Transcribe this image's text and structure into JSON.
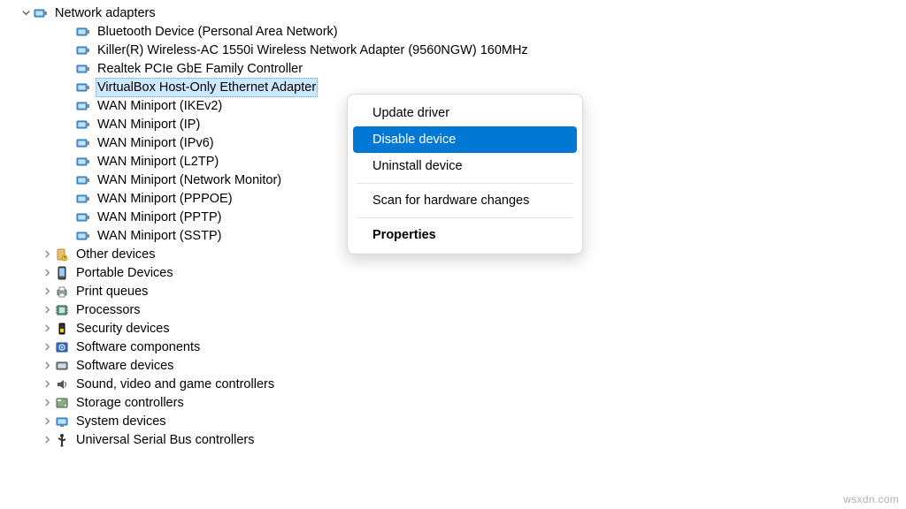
{
  "tree": {
    "root": {
      "label": "Network adapters",
      "icon": "network-adapter-icon",
      "expanded": true
    },
    "devices": [
      {
        "label": "Bluetooth Device (Personal Area Network)",
        "icon": "network-adapter-icon"
      },
      {
        "label": "Killer(R) Wireless-AC 1550i Wireless Network Adapter (9560NGW) 160MHz",
        "icon": "network-adapter-icon"
      },
      {
        "label": "Realtek PCIe GbE Family Controller",
        "icon": "network-adapter-icon"
      },
      {
        "label": "VirtualBox Host-Only Ethernet Adapter",
        "icon": "network-adapter-icon",
        "selected": true
      },
      {
        "label": "WAN Miniport (IKEv2)",
        "icon": "network-adapter-icon"
      },
      {
        "label": "WAN Miniport (IP)",
        "icon": "network-adapter-icon"
      },
      {
        "label": "WAN Miniport (IPv6)",
        "icon": "network-adapter-icon"
      },
      {
        "label": "WAN Miniport (L2TP)",
        "icon": "network-adapter-icon"
      },
      {
        "label": "WAN Miniport (Network Monitor)",
        "icon": "network-adapter-icon"
      },
      {
        "label": "WAN Miniport (PPPOE)",
        "icon": "network-adapter-icon"
      },
      {
        "label": "WAN Miniport (PPTP)",
        "icon": "network-adapter-icon"
      },
      {
        "label": "WAN Miniport (SSTP)",
        "icon": "network-adapter-icon"
      }
    ],
    "categories": [
      {
        "label": "Other devices",
        "icon": "other-devices-icon"
      },
      {
        "label": "Portable Devices",
        "icon": "portable-devices-icon"
      },
      {
        "label": "Print queues",
        "icon": "printer-icon"
      },
      {
        "label": "Processors",
        "icon": "processor-icon"
      },
      {
        "label": "Security devices",
        "icon": "security-device-icon"
      },
      {
        "label": "Software components",
        "icon": "software-component-icon"
      },
      {
        "label": "Software devices",
        "icon": "software-device-icon"
      },
      {
        "label": "Sound, video and game controllers",
        "icon": "sound-icon"
      },
      {
        "label": "Storage controllers",
        "icon": "storage-icon"
      },
      {
        "label": "System devices",
        "icon": "system-device-icon"
      },
      {
        "label": "Universal Serial Bus controllers",
        "icon": "usb-icon"
      }
    ]
  },
  "context_menu": {
    "items": [
      {
        "label": "Update driver",
        "type": "item"
      },
      {
        "label": "Disable device",
        "type": "item",
        "hover": true
      },
      {
        "label": "Uninstall device",
        "type": "item"
      },
      {
        "type": "sep"
      },
      {
        "label": "Scan for hardware changes",
        "type": "item"
      },
      {
        "type": "sep"
      },
      {
        "label": "Properties",
        "type": "item",
        "bold": true
      }
    ]
  },
  "watermark": "wsxdn.com"
}
